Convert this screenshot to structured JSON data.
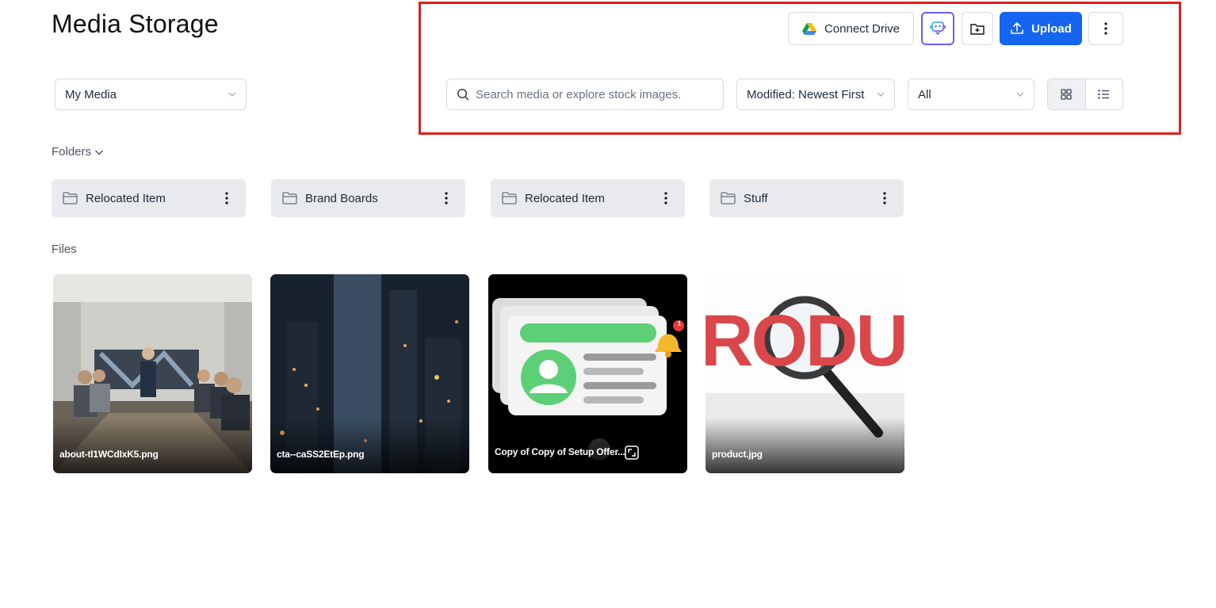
{
  "page": {
    "title": "Media Storage"
  },
  "source_select": {
    "value": "My Media"
  },
  "toolbar": {
    "connect_drive_label": "Connect Drive",
    "upload_label": "Upload",
    "ai_icon": "robot-assistant-icon",
    "new_folder_icon": "folder-plus-icon",
    "more_icon": "kebab-vertical-icon"
  },
  "search": {
    "placeholder": "Search media or explore stock images."
  },
  "sort_select": {
    "value": "Modified: Newest First"
  },
  "type_select": {
    "value": "All"
  },
  "view": {
    "mode": "grid"
  },
  "folders_section": {
    "label": "Folders"
  },
  "folders": [
    {
      "name": "Relocated Item"
    },
    {
      "name": "Brand Boards"
    },
    {
      "name": "Relocated Item"
    },
    {
      "name": "Stuff"
    }
  ],
  "files_section": {
    "label": "Files"
  },
  "files": [
    {
      "name": "about-tl1WCdIxK5.png"
    },
    {
      "name": "cta--caSS2EtEp.png"
    },
    {
      "name": "Copy of Copy of Setup Offer..."
    },
    {
      "name": "product.jpg"
    }
  ],
  "thumbnail_texts": {
    "badge_count": "1",
    "product_word": "RODUC"
  },
  "colors": {
    "primary": "#1565f0",
    "highlight": "#e01e1e",
    "folder_bg": "#e8eaed"
  }
}
